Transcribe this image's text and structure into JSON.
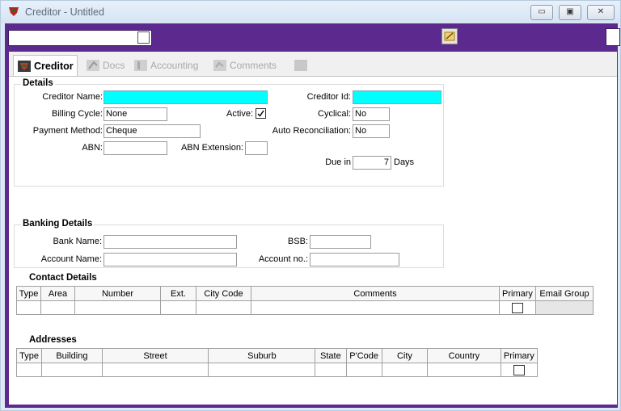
{
  "window": {
    "title": "Creditor - Untitled",
    "min_label": "▭",
    "max_label": "▣",
    "close_label": "✕"
  },
  "tabs": [
    {
      "label": "Creditor"
    },
    {
      "label": "Docs"
    },
    {
      "label": "Accounting"
    },
    {
      "label": "Comments"
    },
    {
      "label": ""
    }
  ],
  "details": {
    "group_title": "Details",
    "creditor_name_label": "Creditor Name:",
    "creditor_name_value": "",
    "creditor_id_label": "Creditor Id:",
    "creditor_id_value": "",
    "billing_cycle_label": "Billing Cycle:",
    "billing_cycle_value": "None",
    "active_label": "Active:",
    "active_checked": true,
    "cyclical_label": "Cyclical:",
    "cyclical_value": "No",
    "payment_method_label": "Payment Method:",
    "payment_method_value": "Cheque",
    "auto_reconciliation_label": "Auto Reconciliation:",
    "auto_reconciliation_value": "No",
    "abn_label": "ABN:",
    "abn_value": "",
    "abn_extension_label": "ABN Extension:",
    "abn_extension_value": "",
    "due_in_label": "Due in",
    "due_in_value": "7",
    "days_label": "Days"
  },
  "banking": {
    "group_title": "Banking Details",
    "bank_name_label": "Bank Name:",
    "bank_name_value": "",
    "bsb_label": "BSB:",
    "bsb_value": "",
    "account_name_label": "Account Name:",
    "account_name_value": "",
    "account_no_label": "Account no.:",
    "account_no_value": ""
  },
  "contacts": {
    "title": "Contact Details",
    "columns": [
      "Type",
      "Area",
      "Number",
      "Ext.",
      "City Code",
      "Comments",
      "Primary",
      "Email Group"
    ]
  },
  "addresses": {
    "title": "Addresses",
    "columns": [
      "Type",
      "Building",
      "Street",
      "Suburb",
      "State",
      "P'Code",
      "City",
      "Country",
      "Primary"
    ]
  },
  "colors": {
    "frame": "#5c2a8e",
    "required_field": "#00ffff"
  },
  "icons": [
    "app-icon",
    "lamp-icon",
    "creditor-tab-icon",
    "docs-tab-icon",
    "accounting-tab-icon",
    "comments-tab-icon",
    "blank-tab-icon"
  ]
}
